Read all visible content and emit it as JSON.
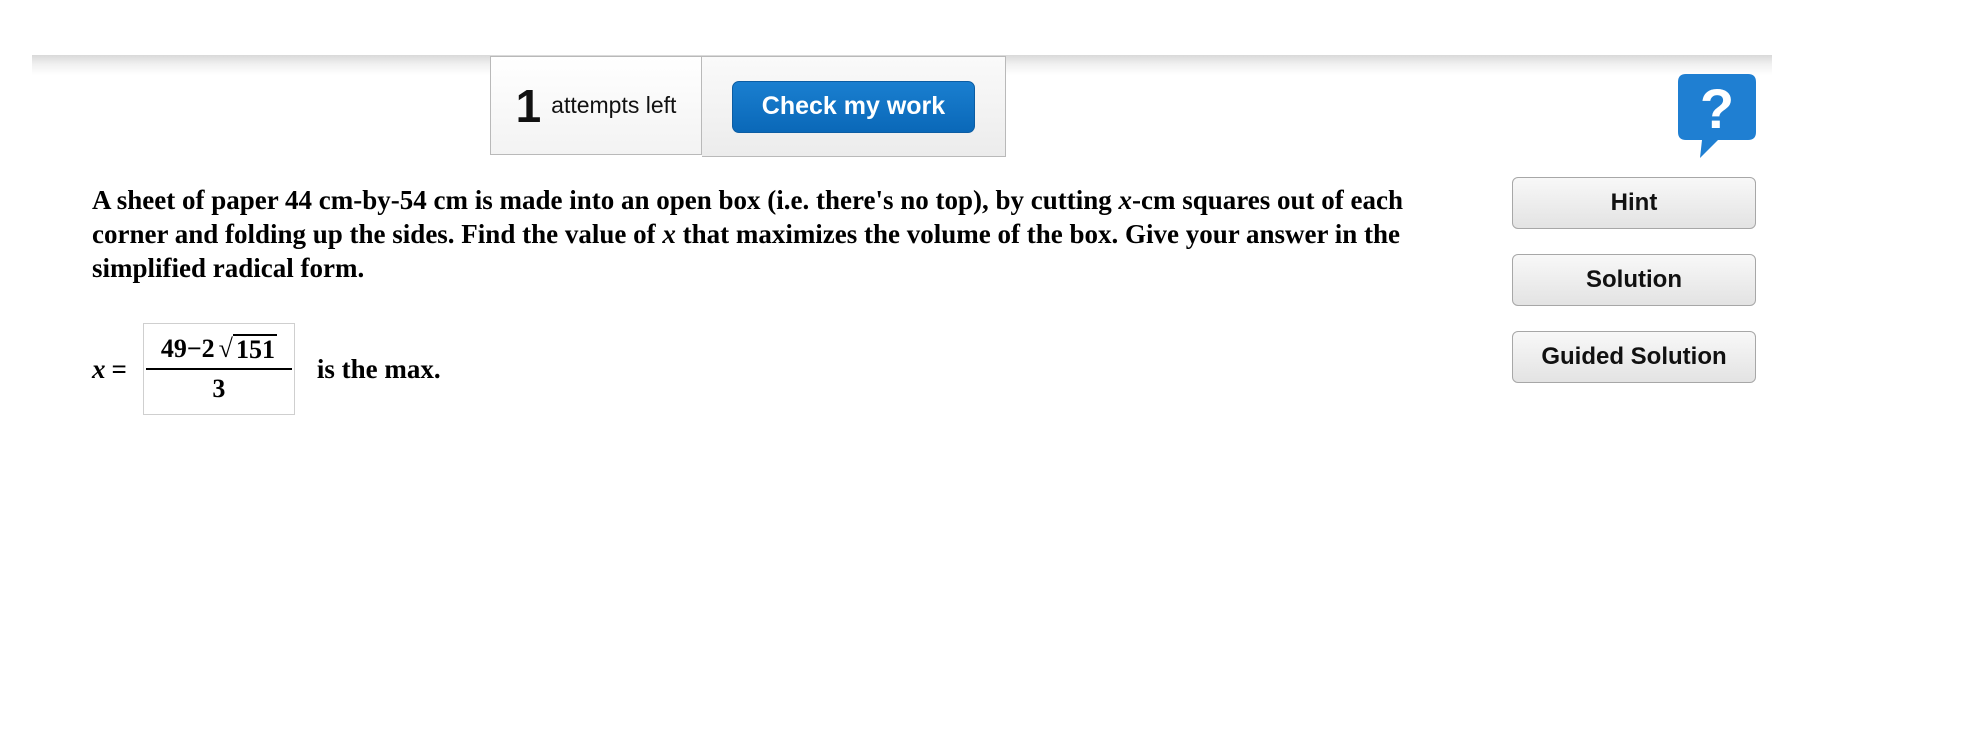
{
  "toolbar": {
    "attempts_count": "1",
    "attempts_label": "attempts left",
    "check_button_label": "Check my work"
  },
  "help": {
    "icon": "question-mark-icon",
    "glyph": "?",
    "color": "#1f7fd2"
  },
  "sidebar": {
    "buttons": [
      {
        "label": "Hint"
      },
      {
        "label": "Solution"
      },
      {
        "label": "Guided Solution"
      }
    ]
  },
  "question": {
    "part1": "A sheet of paper 44 cm-by-54 cm is made into an open box (i.e. there's no top), by cutting ",
    "var1": "x",
    "part2": "-cm squares out of each corner and folding up the sides. Find the value of ",
    "var2": "x",
    "part3": " that maximizes the volume of the box. Give your answer in the simplified radical form."
  },
  "answer": {
    "variable": "x",
    "equals": "=",
    "numerator_prefix": "49−2",
    "radical_symbol": "√",
    "radicand": "151",
    "denominator": "3",
    "suffix": "is the max."
  },
  "colors": {
    "accent": "#0a68b8",
    "button_bg": "#e8e8e8"
  }
}
